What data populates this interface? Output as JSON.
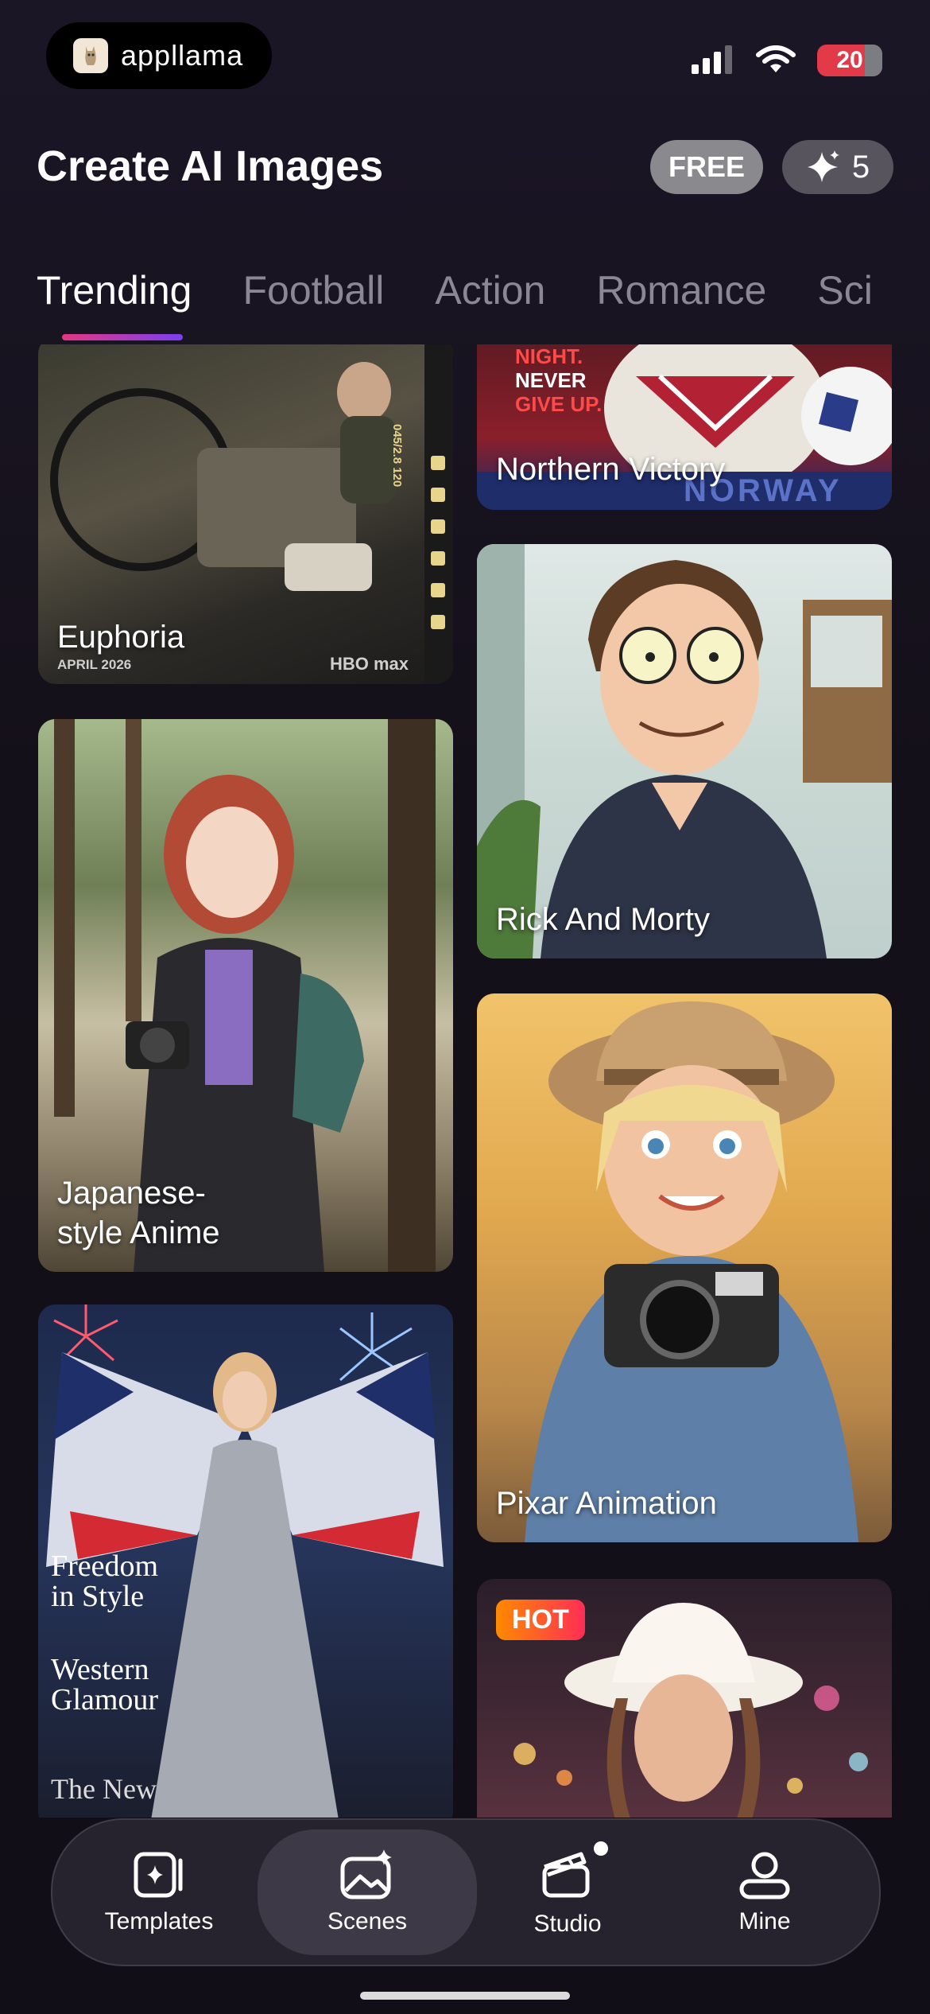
{
  "status_bar": {
    "app_logo_text": "appllama",
    "battery": "20"
  },
  "header": {
    "title": "Create AI Images",
    "free_badge": "FREE",
    "credits": "5"
  },
  "tabs": [
    {
      "label": "Trending",
      "active": true
    },
    {
      "label": "Football"
    },
    {
      "label": "Action"
    },
    {
      "label": "Romance"
    },
    {
      "label": "Sci"
    }
  ],
  "cards": [
    {
      "label": "Euphoria",
      "column": "left",
      "overlay_small": "APRIL 2026",
      "overlay_brand": "HBO max",
      "overlay_film": "045/2.8 120"
    },
    {
      "label": "Japanese-\nstyle Anime",
      "column": "left"
    },
    {
      "label": "",
      "column": "left",
      "overlay_text": [
        "Freedom",
        "in Style",
        "Western",
        "Glamour",
        "The New"
      ]
    },
    {
      "label": "Northern Victory",
      "column": "right",
      "overlay_text": [
        "NIGHT.",
        "NEVER",
        "GIVE UP.",
        "NORWAY"
      ]
    },
    {
      "label": "Rick And Morty",
      "column": "right"
    },
    {
      "label": "Pixar Animation",
      "column": "right"
    },
    {
      "label": "",
      "column": "right",
      "badge": "HOT"
    }
  ],
  "nav": [
    {
      "label": "Templates",
      "icon": "templates-icon"
    },
    {
      "label": "Scenes",
      "icon": "scenes-icon",
      "active": true
    },
    {
      "label": "Studio",
      "icon": "studio-icon",
      "dot": true
    },
    {
      "label": "Mine",
      "icon": "profile-icon"
    }
  ]
}
